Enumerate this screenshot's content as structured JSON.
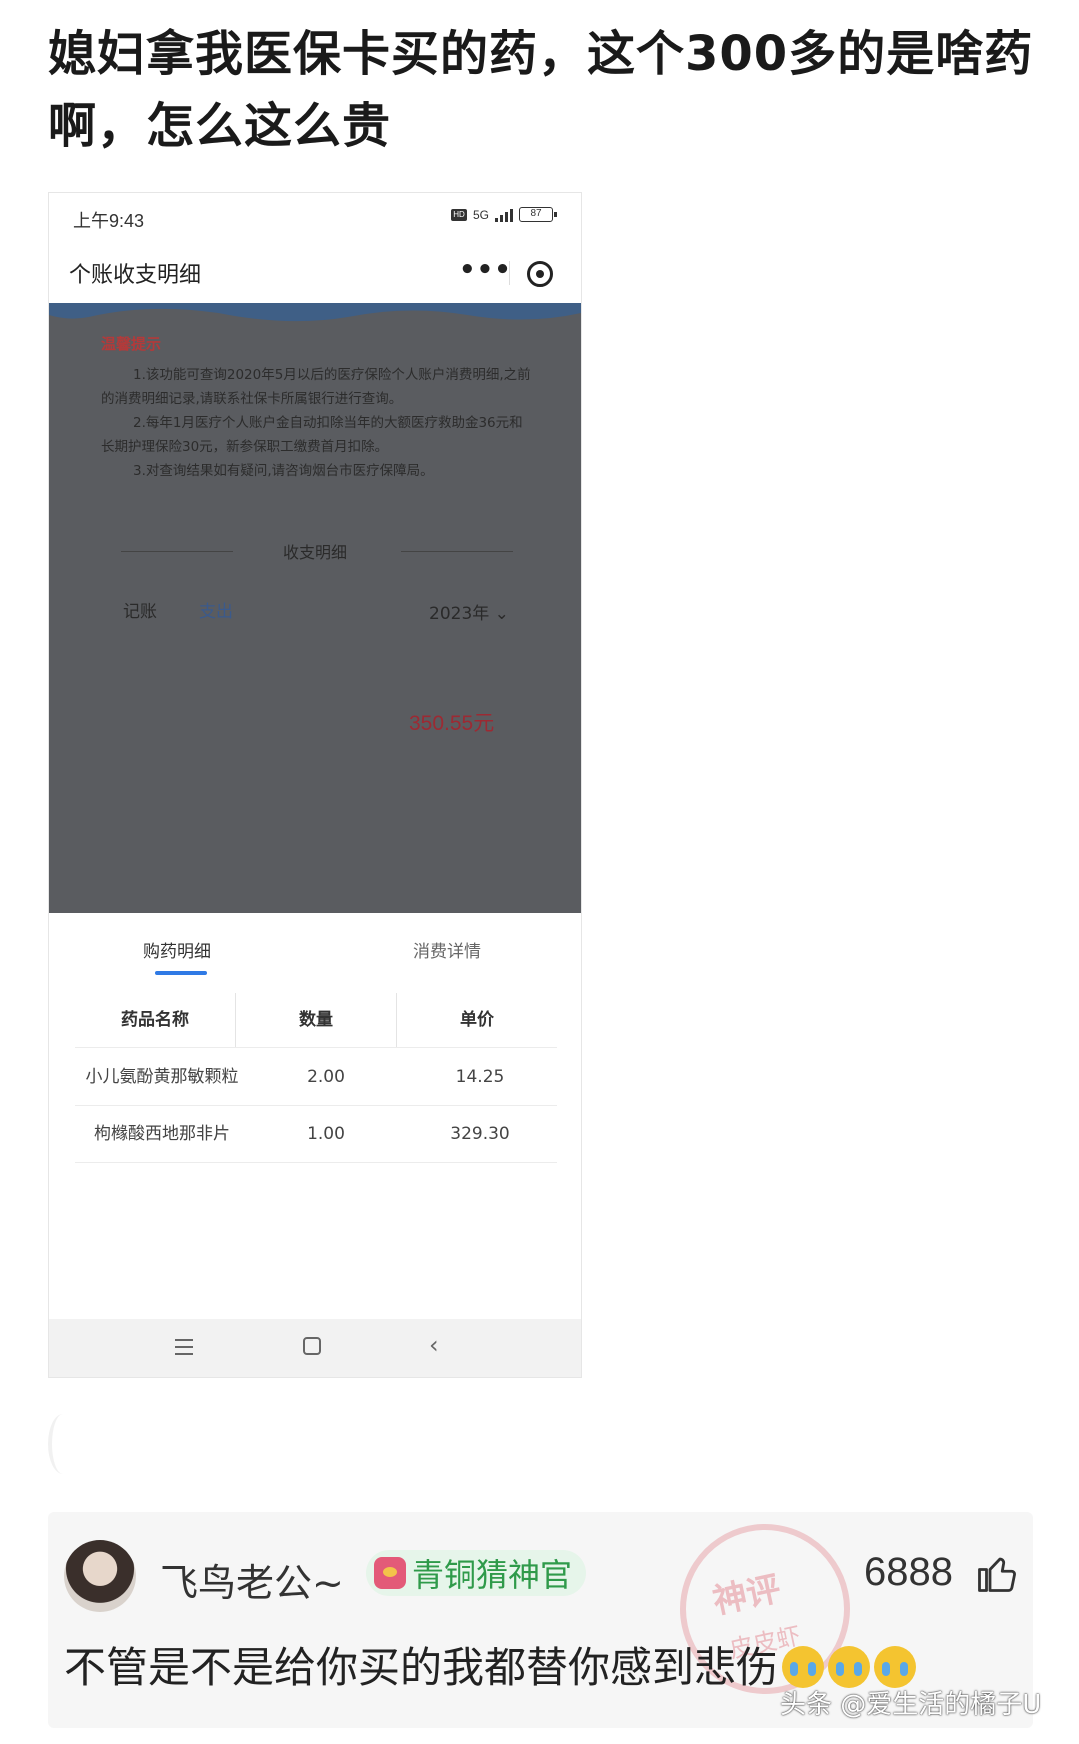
{
  "post": {
    "title": "媳妇拿我医保卡买的药，这个300多的是啥药啊，怎么这么贵"
  },
  "phone": {
    "status_time": "上午9:43",
    "status_hd": "HD",
    "status_network": "5G",
    "battery": "87",
    "page_title": "个账收支明细",
    "tips": {
      "title": "温馨提示",
      "items": [
        "1.该功能可查询2020年5月以后的医疗保险个人账户消费明细,之前的消费明细记录,请联系社保卡所属银行进行查询。",
        "2.每年1月医疗个人账户金自动扣除当年的大额医疗救助金36元和长期护理保险30元，新参保职工缴费首月扣除。",
        "3.对查询结果如有疑问,请咨询烟台市医疗保障局。"
      ]
    },
    "section_title": "收支明细",
    "tab_record": "记账",
    "tab_expense": "支出",
    "year": "2023年",
    "amount": "350.55元",
    "tabs": [
      "购药明细",
      "消费详情"
    ],
    "table": {
      "headers": [
        "药品名称",
        "数量",
        "单价"
      ],
      "rows": [
        [
          "小儿氨酚黄那敏颗粒",
          "2.00",
          "14.25"
        ],
        [
          "枸橼酸西地那非片",
          "1.00",
          "329.30"
        ]
      ]
    }
  },
  "comment": {
    "username": "飞鸟老公~",
    "badge": "青铜猜神官",
    "stamp_top": "神评",
    "stamp_bottom": "皮皮虾",
    "likes": "6888",
    "text": "不管是不是给你买的我都替你感到悲伤",
    "emoji_count": 3
  },
  "watermark": "头条 @爱生活的橘子U",
  "colors": {
    "overlay": "#5a5c60",
    "amount": "#9c2a33",
    "tab_accent": "#2f7ae5",
    "badge_text": "#2f9a4a"
  }
}
